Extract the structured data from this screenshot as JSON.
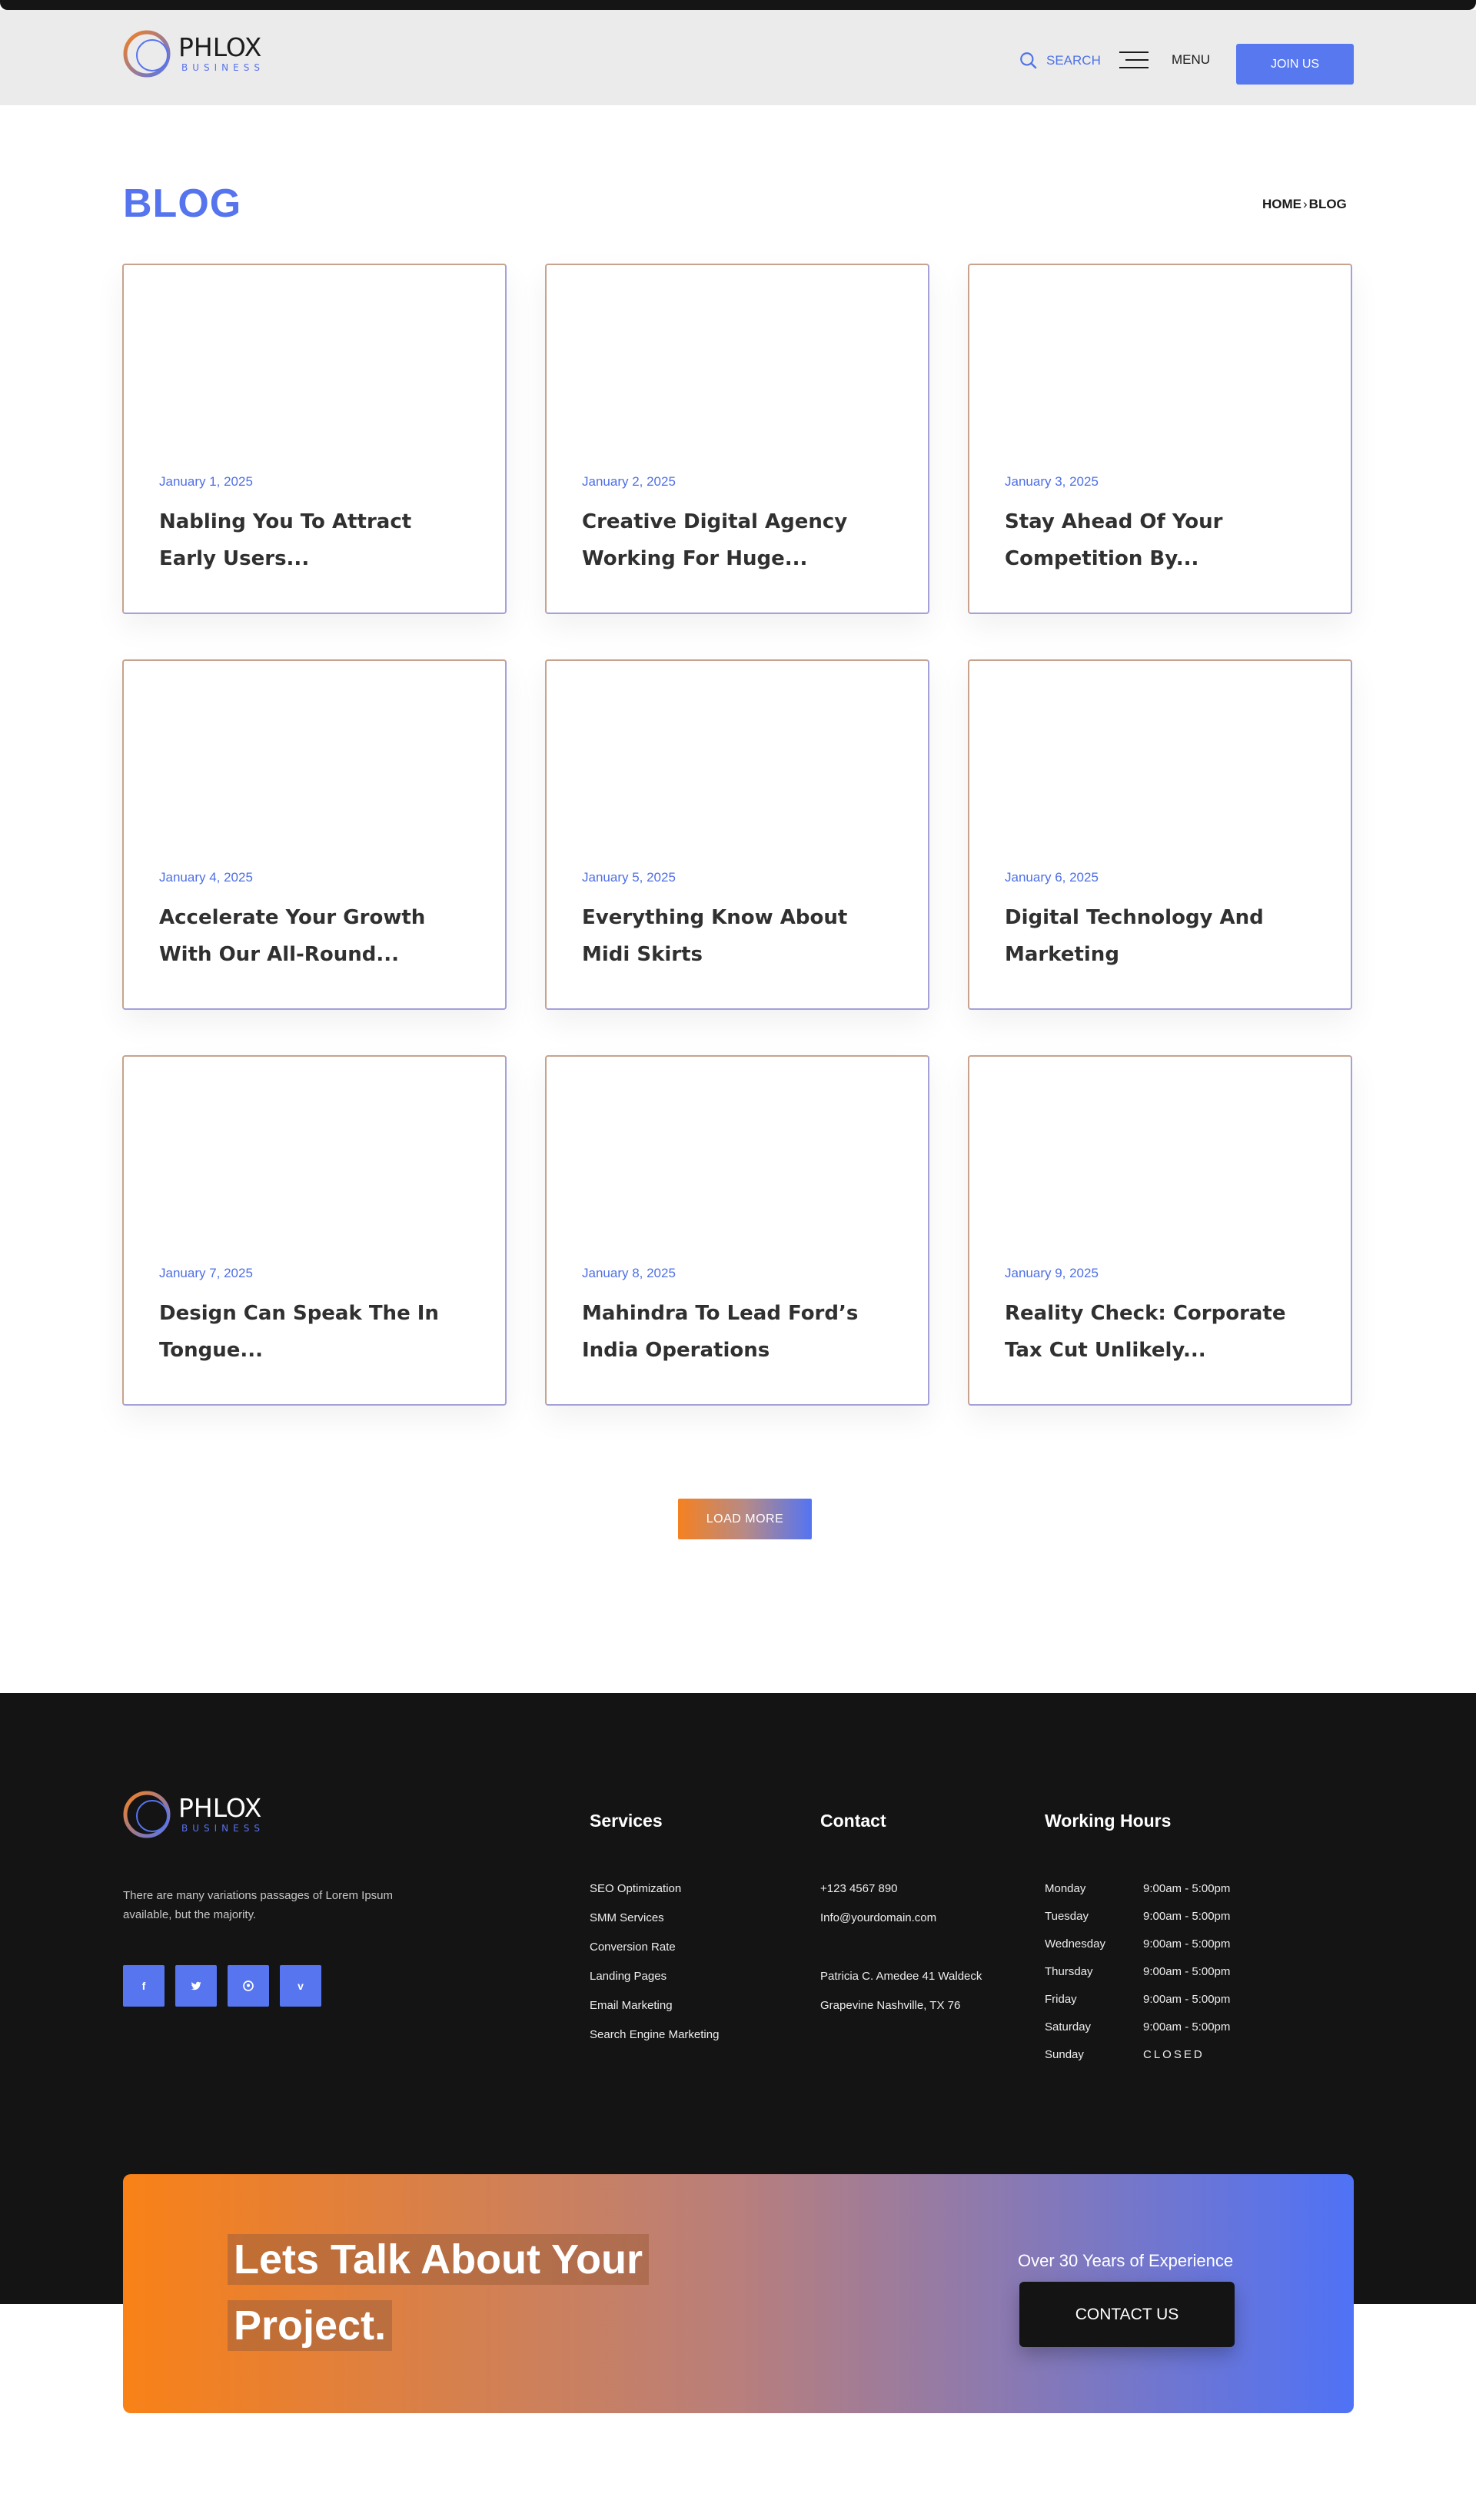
{
  "brand": {
    "name": "PHLOX",
    "tagline": "BUSINESS"
  },
  "header": {
    "search_label": "SEARCH",
    "menu_label": "MENU",
    "join_label": "JOIN US"
  },
  "page": {
    "title": "BLOG"
  },
  "breadcrumb": {
    "home": "HOME",
    "current": "BLOG"
  },
  "posts": [
    {
      "date": "January 1, 2025",
      "title": "Nabling You To Attract Early Users..."
    },
    {
      "date": "January 2, 2025",
      "title": "Creative Digital Agency Working For Huge..."
    },
    {
      "date": "January 3, 2025",
      "title": "Stay Ahead Of Your Competition By..."
    },
    {
      "date": "January 4, 2025",
      "title": "Accelerate Your Growth With Our All-Round..."
    },
    {
      "date": "January 5, 2025",
      "title": "Everything Know About Midi Skirts"
    },
    {
      "date": "January 6, 2025",
      "title": "Digital Technology And Marketing"
    },
    {
      "date": "January 7, 2025",
      "title": "Design Can Speak The In Tongue..."
    },
    {
      "date": "January 8, 2025",
      "title": "Mahindra To Lead Ford’s India Operations"
    },
    {
      "date": "January 9, 2025",
      "title": "Reality Check: Corporate Tax Cut Unlikely..."
    }
  ],
  "load_more_label": "LOAD MORE",
  "footer": {
    "description": "There are many variations passages of Lorem Ipsum available, but the majority.",
    "social": [
      {
        "icon": "facebook-icon",
        "glyph": "f"
      },
      {
        "icon": "twitter-icon",
        "glyph": "🐦"
      },
      {
        "icon": "pinterest-icon",
        "glyph": "◎"
      },
      {
        "icon": "vimeo-icon",
        "glyph": "v"
      }
    ],
    "services": {
      "heading": "Services",
      "items": [
        "SEO Optimization",
        "SMM Services",
        "Conversion Rate",
        "Landing Pages",
        "Email Marketing",
        "Search Engine Marketing"
      ]
    },
    "contact": {
      "heading": "Contact",
      "phone": "+123 4567 890",
      "email": "Info@yourdomain.com",
      "address_line1": "Patricia C. Amedee 41 Waldeck",
      "address_line2": "Grapevine Nashville, TX 76"
    },
    "hours": {
      "heading": "Working Hours",
      "rows": [
        {
          "day": "Monday",
          "time": "9:00am - 5:00pm"
        },
        {
          "day": "Tuesday",
          "time": "9:00am - 5:00pm"
        },
        {
          "day": "Wednesday",
          "time": "9:00am - 5:00pm"
        },
        {
          "day": "Thursday",
          "time": "9:00am - 5:00pm"
        },
        {
          "day": "Friday",
          "time": "9:00am - 5:00pm"
        },
        {
          "day": "Saturday",
          "time": "9:00am - 5:00pm"
        },
        {
          "day": "Sunday",
          "time": "CLOSED"
        }
      ]
    }
  },
  "cta": {
    "title_line1": "Lets Talk About Your",
    "title_line2": "Project.",
    "experience": "Over 30 Years of Experience",
    "button_label": "CONTACT US"
  },
  "colors": {
    "accent": "#5674ee",
    "orange": "#f58120",
    "dark": "#141414"
  }
}
